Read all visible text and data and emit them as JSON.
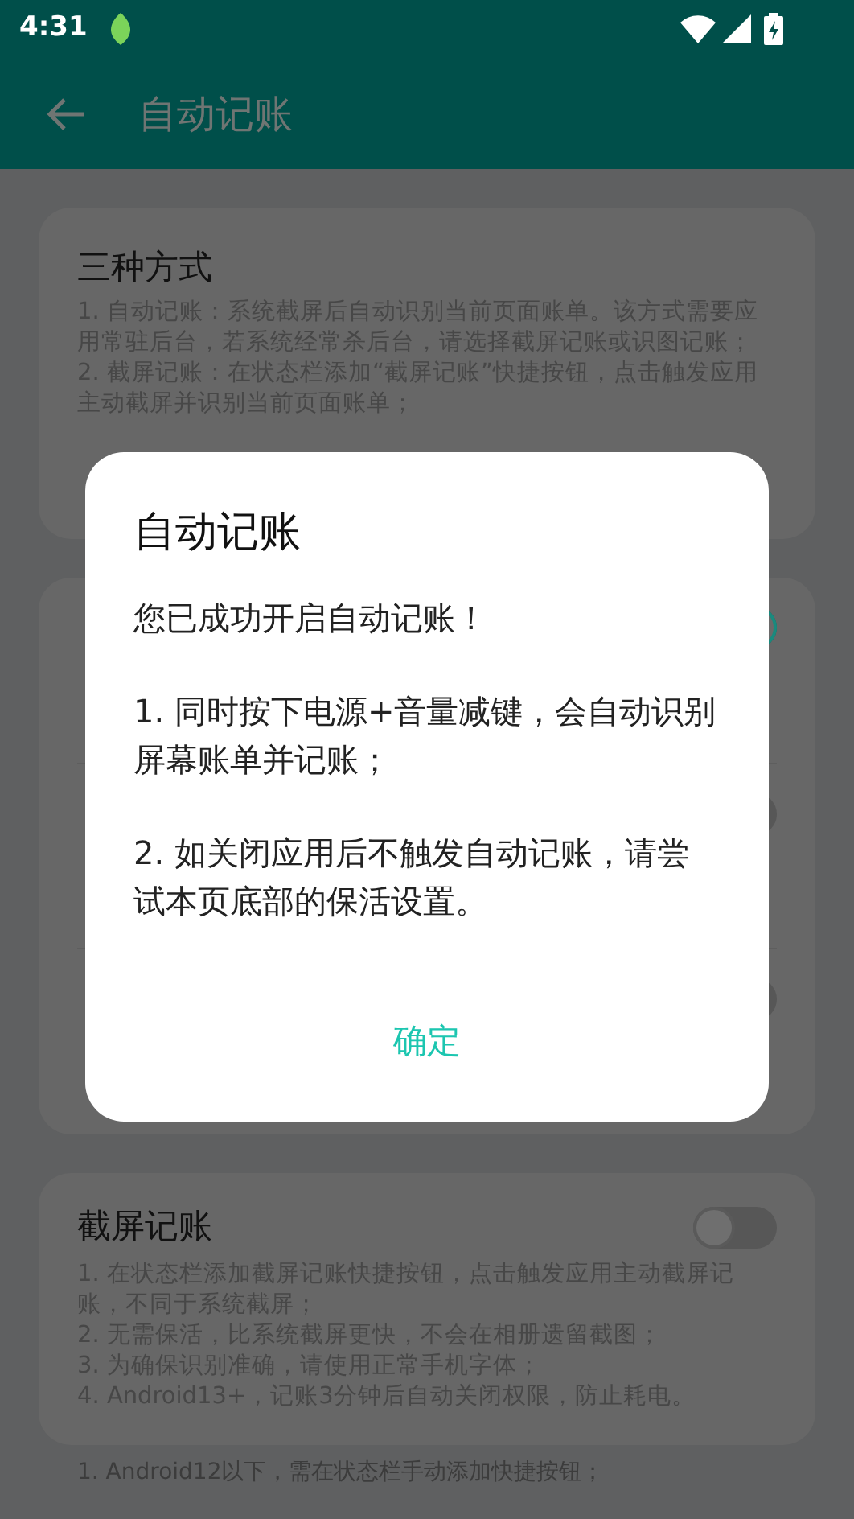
{
  "status_bar": {
    "time": "4:31"
  },
  "app_bar": {
    "title": "自动记账"
  },
  "cards": [
    {
      "title": "三种方式",
      "description": "1. 自动记账：系统截屏后自动识别当前页面账单。该方式需要应用常驻后台，若系统经常杀后台，请选择截屏记账或识图记账；\n2. 截屏记账：在状态栏添加“截屏记账”快捷按钮，点击触发应用主动截屏并识别当前页面账单；"
    },
    {
      "rows": [
        {
          "on": true
        },
        {
          "on": false
        },
        {
          "on": false
        }
      ]
    },
    {
      "title": "截屏记账",
      "on": false,
      "description": "1. 在状态栏添加截屏记账快捷按钮，点击触发应用主动截屏记账，不同于系统截屏；\n2. 无需保活，比系统截屏更快，不会在相册遗留截图；\n3. 为确保识别准确，请使用正常手机字体；\n4. Android13+，记账3分钟后自动关闭权限，防止耗电。"
    }
  ],
  "footer_text": "1. Android12以下，需在状态栏手动添加快捷按钮；",
  "dialog": {
    "title": "自动记账",
    "paragraphs": [
      "您已成功开启自动记账！",
      "1. 同时按下电源+音量减键，会自动识别屏幕账单并记账；",
      "2. 如关闭应用后不触发自动记账，请尝试本页底部的保活设置。"
    ],
    "button": "确定"
  }
}
